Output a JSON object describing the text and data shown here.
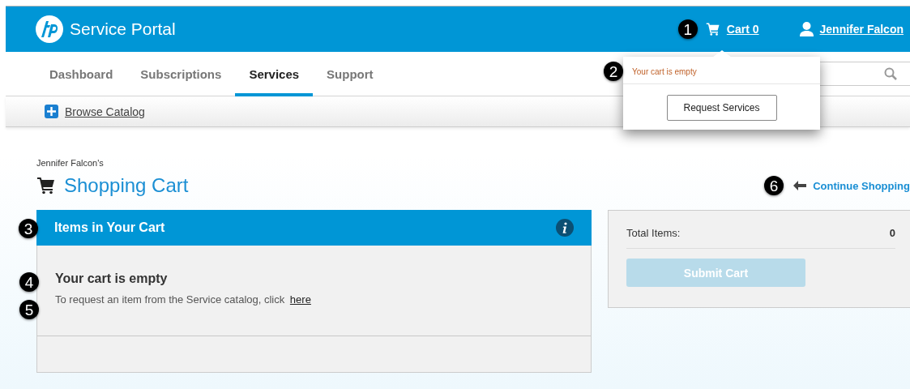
{
  "header": {
    "brand": "Service Portal",
    "cart": {
      "marker": "1",
      "label": "Cart 0"
    },
    "user": "Jennifer Falcon"
  },
  "nav": {
    "tabs": [
      {
        "label": "Dashboard",
        "selected": false
      },
      {
        "label": "Subscriptions",
        "selected": false
      },
      {
        "label": "Services",
        "selected": true
      },
      {
        "label": "Support",
        "selected": false
      }
    ]
  },
  "cart_popup": {
    "marker": "2",
    "message": "Your cart is empty",
    "button": "Request Services"
  },
  "toolbar": {
    "link": "Browse Catalog"
  },
  "page": {
    "owner": "Jennifer Falcon's",
    "title": "Shopping Cart",
    "continue": {
      "marker": "6",
      "label": "Continue Shopping"
    }
  },
  "items_panel": {
    "marker": "3",
    "title": "Items in Your Cart",
    "empty": {
      "marker": "4",
      "title": "Your cart is empty"
    },
    "hint": {
      "marker": "5",
      "text": "To request an item from the Service catalog, click",
      "link": "here"
    }
  },
  "summary": {
    "label": "Total Items:",
    "value": "0",
    "button": {
      "label": "Submit Cart",
      "disabled": true
    }
  }
}
